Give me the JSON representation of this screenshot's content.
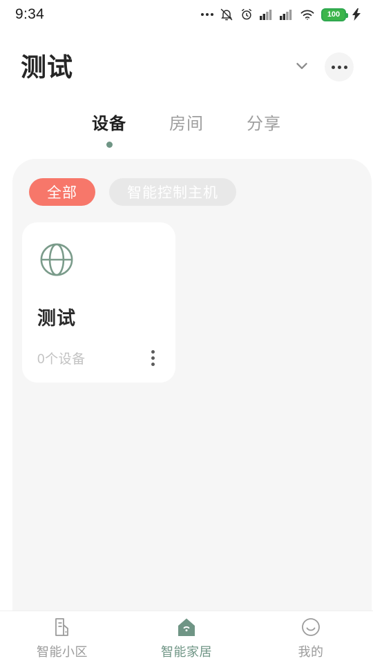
{
  "status_bar": {
    "time": "9:34",
    "battery_level": "100",
    "icons": [
      "more-dots-icon",
      "bell-muted-icon",
      "alarm-clock-icon",
      "signal-bars-icon",
      "signal-bars-icon",
      "wifi-icon",
      "battery-icon",
      "charging-bolt-icon"
    ]
  },
  "header": {
    "title": "测试",
    "chevron_icon": "chevron-down-icon",
    "more_icon": "more-horizontal-icon"
  },
  "tabs": [
    {
      "label": "设备",
      "active": true
    },
    {
      "label": "房间",
      "active": false
    },
    {
      "label": "分享",
      "active": false
    }
  ],
  "filters": [
    {
      "label": "全部",
      "active": true
    },
    {
      "label": "智能控制主机",
      "active": false
    }
  ],
  "devices": [
    {
      "icon": "globe-icon",
      "title": "测试",
      "subtitle": "0个设备",
      "menu_icon": "more-vertical-icon"
    }
  ],
  "bottom_nav": [
    {
      "label": "智能小区",
      "icon": "building-icon",
      "active": false
    },
    {
      "label": "智能家居",
      "icon": "home-wifi-icon",
      "active": true
    },
    {
      "label": "我的",
      "icon": "smiley-face-icon",
      "active": false
    }
  ],
  "colors": {
    "accent_green": "#6f9585",
    "accent_coral": "#f7776a",
    "panel_bg": "#f6f6f6",
    "card_bg": "#ffffff",
    "battery_green": "#3cb54a"
  }
}
